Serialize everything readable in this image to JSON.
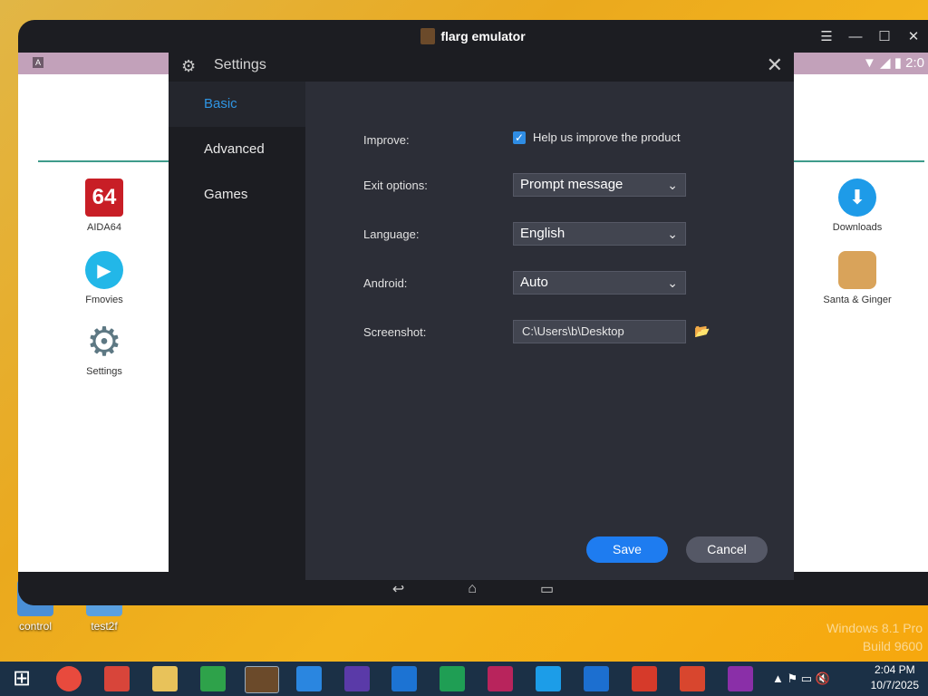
{
  "desktop": {
    "icons": [
      {
        "label": "control"
      },
      {
        "label": "test2f"
      }
    ],
    "watermark_line1": "Windows 8.1 Pro",
    "watermark_line2": "Build 9600"
  },
  "emulator": {
    "title": "flarg emulator",
    "status_time": "2:0"
  },
  "home": {
    "apps_left": [
      {
        "label": "AIDA64",
        "icon": "aida64-icon"
      },
      {
        "label": "Fmovies",
        "icon": "play-icon"
      },
      {
        "label": "Settings",
        "icon": "gear-icon"
      }
    ],
    "apps_right": [
      {
        "label": "Downloads",
        "icon": "download-icon"
      },
      {
        "label": "Santa & Ginger",
        "icon": "santa-ginger-icon"
      }
    ],
    "aida_text": "64"
  },
  "settings": {
    "title": "Settings",
    "nav": [
      {
        "label": "Basic",
        "active": true
      },
      {
        "label": "Advanced",
        "active": false
      },
      {
        "label": "Games",
        "active": false
      }
    ],
    "improve": {
      "label": "Improve:",
      "checkbox_label": "Help us improve the product",
      "checked": true
    },
    "exit_options": {
      "label": "Exit options:",
      "value": "Prompt message"
    },
    "language": {
      "label": "Language:",
      "value": "English"
    },
    "android": {
      "label": "Android:",
      "value": "Auto"
    },
    "screenshot": {
      "label": "Screenshot:",
      "value": "C:\\Users\\b\\Desktop"
    },
    "save_label": "Save",
    "cancel_label": "Cancel"
  },
  "taskbar": {
    "time": "2:04 PM",
    "date": "10/7/2025"
  },
  "colors": {
    "accent": "#1e7cf0",
    "active_nav": "#2f95e3",
    "dialog_bg": "#2c2e37",
    "sidebar_bg": "#1c1d22"
  }
}
